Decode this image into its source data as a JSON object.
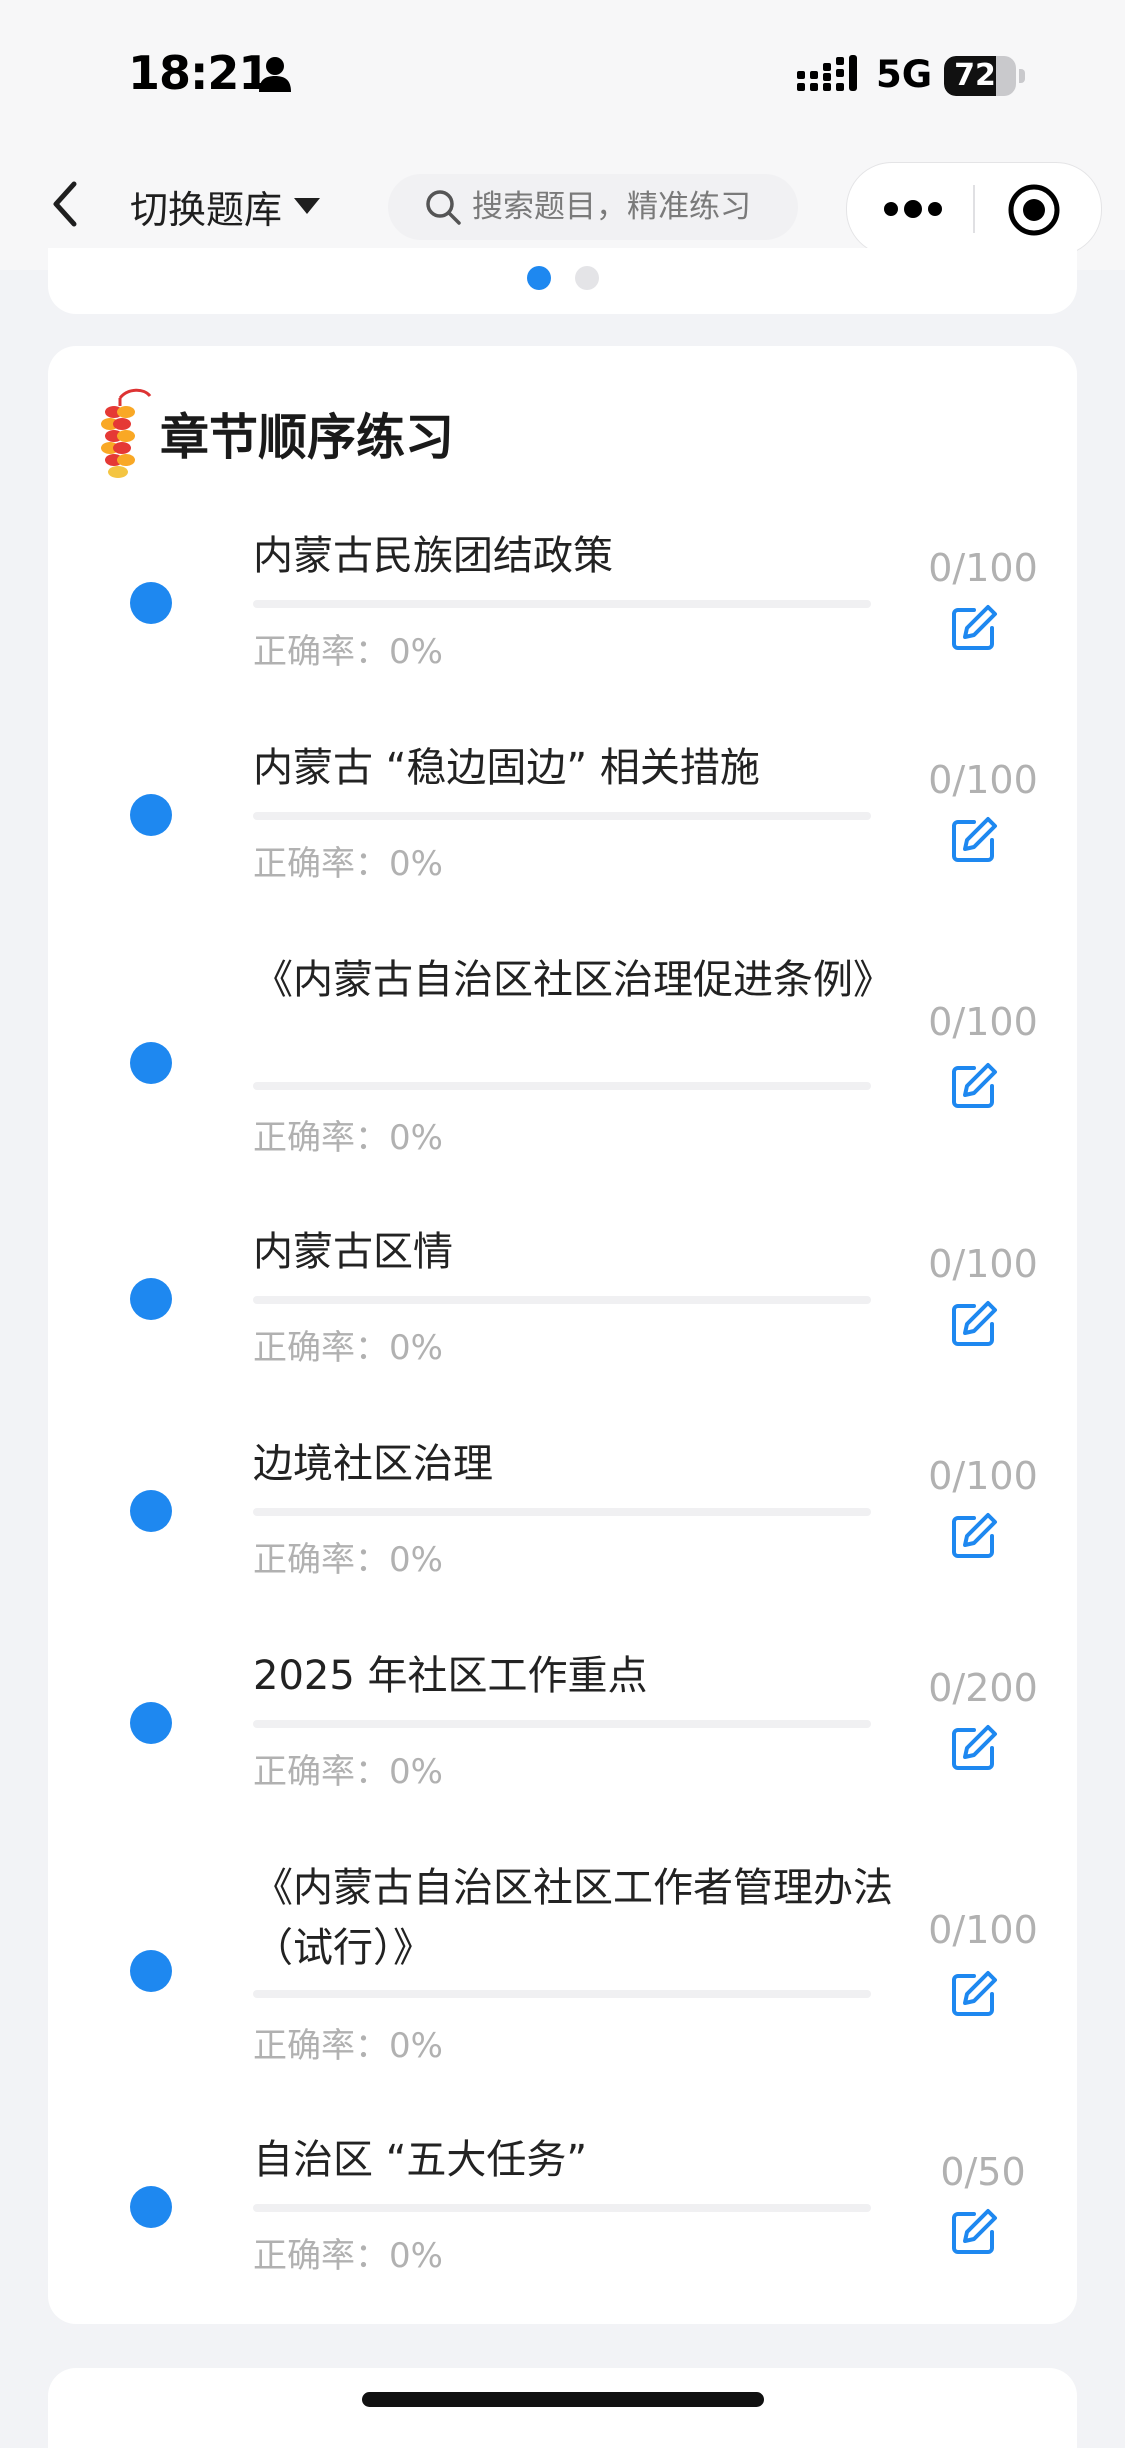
{
  "status_bar": {
    "time": "18:21",
    "network": "5G",
    "battery": "72",
    "battery_level": 0.72,
    "icons": [
      "person-icon",
      "signal-icon",
      "battery-icon"
    ]
  },
  "nav": {
    "switch_label": "切换题库",
    "search_placeholder": "搜索题目，精准练习",
    "icons": [
      "back-icon",
      "caret-down-icon",
      "search-icon",
      "more-icon",
      "close-target-icon"
    ]
  },
  "top_card": {
    "pagination_active": 1,
    "pagination_total": 2
  },
  "chapter": {
    "title": "章节顺序练习",
    "icon": "firecracker-icon",
    "items": [
      {
        "title": "内蒙古民族团结政策",
        "accuracy": "正确率：0%",
        "count": "0/100"
      },
      {
        "title": "内蒙古 “稳边固边” 相关措施",
        "accuracy": "正确率：0%",
        "count": "0/100"
      },
      {
        "title": "《内蒙古自治区社区治理促进条例》",
        "accuracy": "正确率：0%",
        "count": "0/100"
      },
      {
        "title": "内蒙古区情",
        "accuracy": "正确率：0%",
        "count": "0/100"
      },
      {
        "title": "边境社区治理",
        "accuracy": "正确率：0%",
        "count": "0/100"
      },
      {
        "title": "2025 年社区工作重点",
        "accuracy": "正确率：0%",
        "count": "0/200"
      },
      {
        "title": "《内蒙古自治区社区工作者管理办法（试行）》",
        "accuracy": "正确率：0%",
        "count": "0/100"
      },
      {
        "title": "自治区 “五大任务”",
        "accuracy": "正确率：0%",
        "count": "0/50"
      }
    ]
  },
  "colors": {
    "accent": "#1e88f0",
    "muted": "#b1b1b1",
    "background": "#f2f3f6"
  }
}
